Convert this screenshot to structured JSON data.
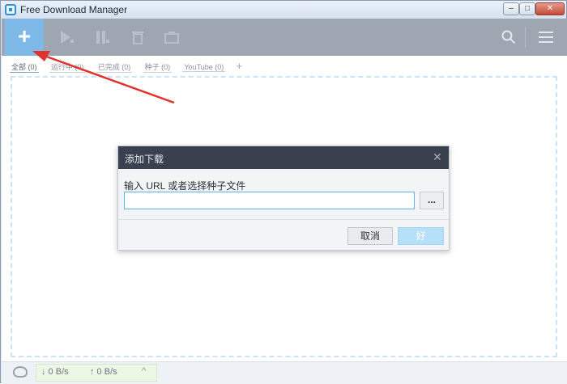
{
  "window": {
    "title": "Free Download Manager",
    "controls": {
      "minimize": "–",
      "maximize": "□",
      "close": "✕"
    }
  },
  "toolbar": {
    "add_icon": "+",
    "icons": [
      "add-icon",
      "play-icon",
      "pause-icon",
      "delete-icon",
      "move-folder-icon",
      "search-icon",
      "menu-icon"
    ]
  },
  "tabs": {
    "items": [
      {
        "label": "全部 (0)"
      },
      {
        "label": "运行中 (0)"
      },
      {
        "label": "已完成 (0)"
      },
      {
        "label": "种子 (0)"
      },
      {
        "label": "YouTube (0)"
      }
    ],
    "add_label": "+"
  },
  "status": {
    "download_speed": "↓ 0 B/s",
    "upload_speed": "↑ 0 B/s",
    "toggle": "^"
  },
  "dialog": {
    "title": "添加下载",
    "close": "✕",
    "label": "输入 URL 或者选择种子文件",
    "input_value": "",
    "browse_label": "...",
    "cancel_label": "取消",
    "ok_label": "好"
  },
  "colors": {
    "toolbar_bg": "#9ea6b2",
    "add_button_bg": "#7fb9e8",
    "dialog_header_bg": "#39414e",
    "ok_button_bg": "#b6e0f8",
    "arrow_color": "#e0332b"
  }
}
